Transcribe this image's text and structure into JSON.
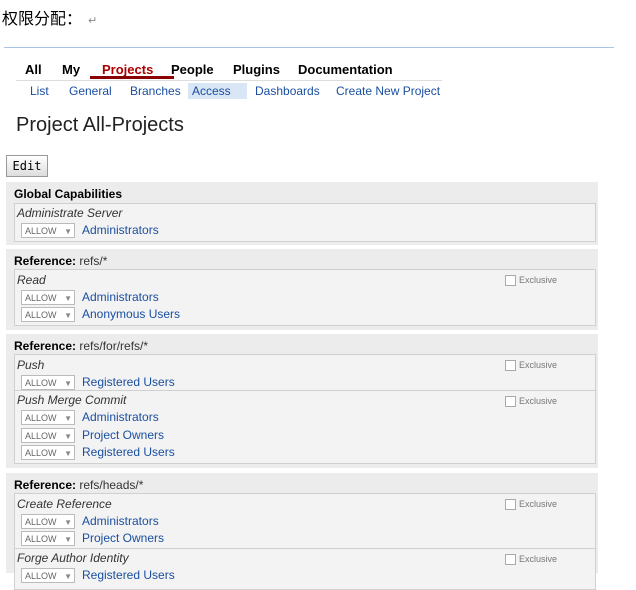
{
  "doc_title": "权限分配：",
  "doc_mark": "↵",
  "topnav": {
    "items": [
      {
        "label": "All"
      },
      {
        "label": "My"
      },
      {
        "label": "Projects"
      },
      {
        "label": "People"
      },
      {
        "label": "Plugins"
      },
      {
        "label": "Documentation"
      }
    ],
    "active": "Projects"
  },
  "subnav": {
    "items": [
      {
        "label": "List"
      },
      {
        "label": "General"
      },
      {
        "label": "Branches"
      },
      {
        "label": "Access"
      },
      {
        "label": "Dashboards"
      },
      {
        "label": "Create New Project"
      }
    ],
    "selected": "Access"
  },
  "page_title": "Project All-Projects",
  "edit_label": "Edit",
  "allow_label": "ALLOW",
  "exclusive_label": "Exclusive",
  "reference_label": "Reference:",
  "sections": [
    {
      "heading": "Global Capabilities",
      "permissions": [
        {
          "name": "Administrate Server",
          "rules": [
            "Administrators"
          ]
        }
      ]
    },
    {
      "ref": "refs/*",
      "permissions": [
        {
          "name": "Read",
          "rules": [
            "Administrators",
            "Anonymous Users"
          ]
        }
      ]
    },
    {
      "ref": "refs/for/refs/*",
      "permissions": [
        {
          "name": "Push",
          "rules": [
            "Registered Users"
          ]
        },
        {
          "name": "Push Merge Commit",
          "rules": [
            "Administrators",
            "Project Owners",
            "Registered Users"
          ]
        }
      ]
    },
    {
      "ref": "refs/heads/*",
      "permissions": [
        {
          "name": "Create Reference",
          "rules": [
            "Administrators",
            "Project Owners"
          ]
        },
        {
          "name": "Forge Author Identity",
          "rules": [
            "Registered Users"
          ]
        }
      ]
    }
  ]
}
